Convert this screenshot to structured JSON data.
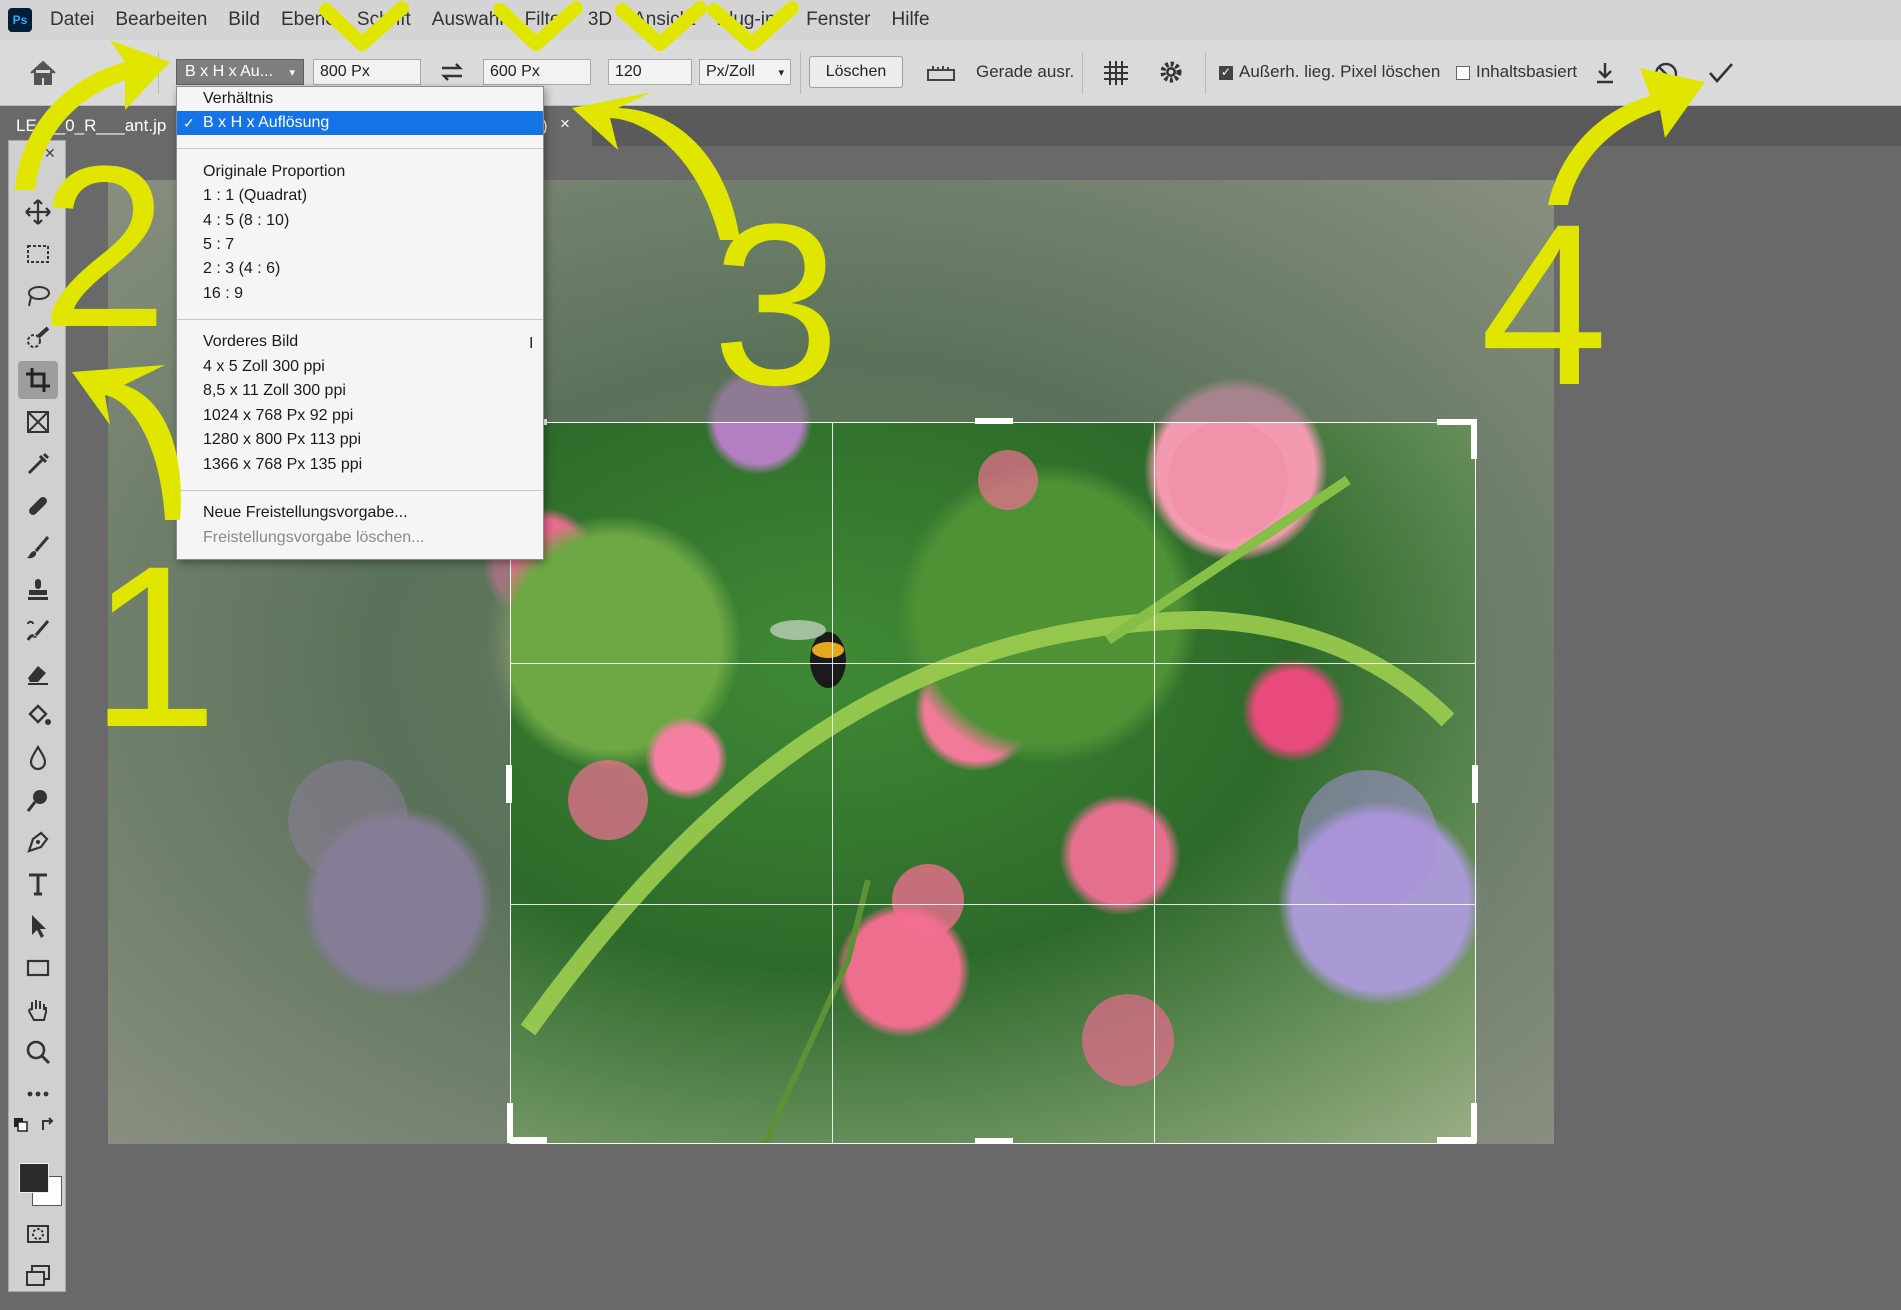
{
  "menu": {
    "app_icon": "Ps",
    "items": [
      "Datei",
      "Bearbeiten",
      "Bild",
      "Ebene",
      "Schrift",
      "Auswahl",
      "Filter",
      "3D",
      "Ansicht",
      "Plug-ins",
      "Fenster",
      "Hilfe"
    ]
  },
  "options": {
    "preset": "B x H x Au...",
    "width": "800 Px",
    "height": "600 Px",
    "resolution": "120",
    "unit": "Px/Zoll",
    "clear_label": "Löschen",
    "straighten_label": "Gerade ausr.",
    "delete_pixels_label": "Außerh. lieg. Pixel löschen",
    "delete_pixels_checked": true,
    "content_aware_label": "Inhaltsbasiert",
    "content_aware_checked": false
  },
  "document_tab": {
    "title": "LE___0_R___ant.jp",
    "title_end": ")",
    "close": "×"
  },
  "dropdown": {
    "items": [
      {
        "label": "Verhältnis",
        "selected": false
      },
      {
        "label": "B x H x Auflösung",
        "selected": true
      },
      {
        "label": "Originale Proportion"
      },
      {
        "label": "1 : 1 (Quadrat)"
      },
      {
        "label": "4 : 5 (8 : 10)"
      },
      {
        "label": "5 : 7"
      },
      {
        "label": "2 : 3 (4 : 6)"
      },
      {
        "label": "16 : 9"
      },
      {
        "label": "Vorderes Bild"
      },
      {
        "label": "4 x 5 Zoll 300 ppi"
      },
      {
        "label": "8,5 x 11 Zoll 300 ppi"
      },
      {
        "label": "1024 x 768 Px 92 ppi"
      },
      {
        "label": "1280 x 800 Px 113 ppi"
      },
      {
        "label": "1366 x 768 Px 135 ppi"
      },
      {
        "label": "Neue Freistellungsvorgabe..."
      },
      {
        "label": "Freistellungsvorgabe löschen...",
        "disabled": true
      }
    ],
    "check_glyph": "✓",
    "text_cursor": "I"
  },
  "annotations": {
    "steps": [
      "1",
      "2",
      "3",
      "4"
    ],
    "color": "#e1e600"
  },
  "colors": {
    "selection": "#1473e6",
    "menubar": "#d4d4d4",
    "workspace": "#696969"
  }
}
